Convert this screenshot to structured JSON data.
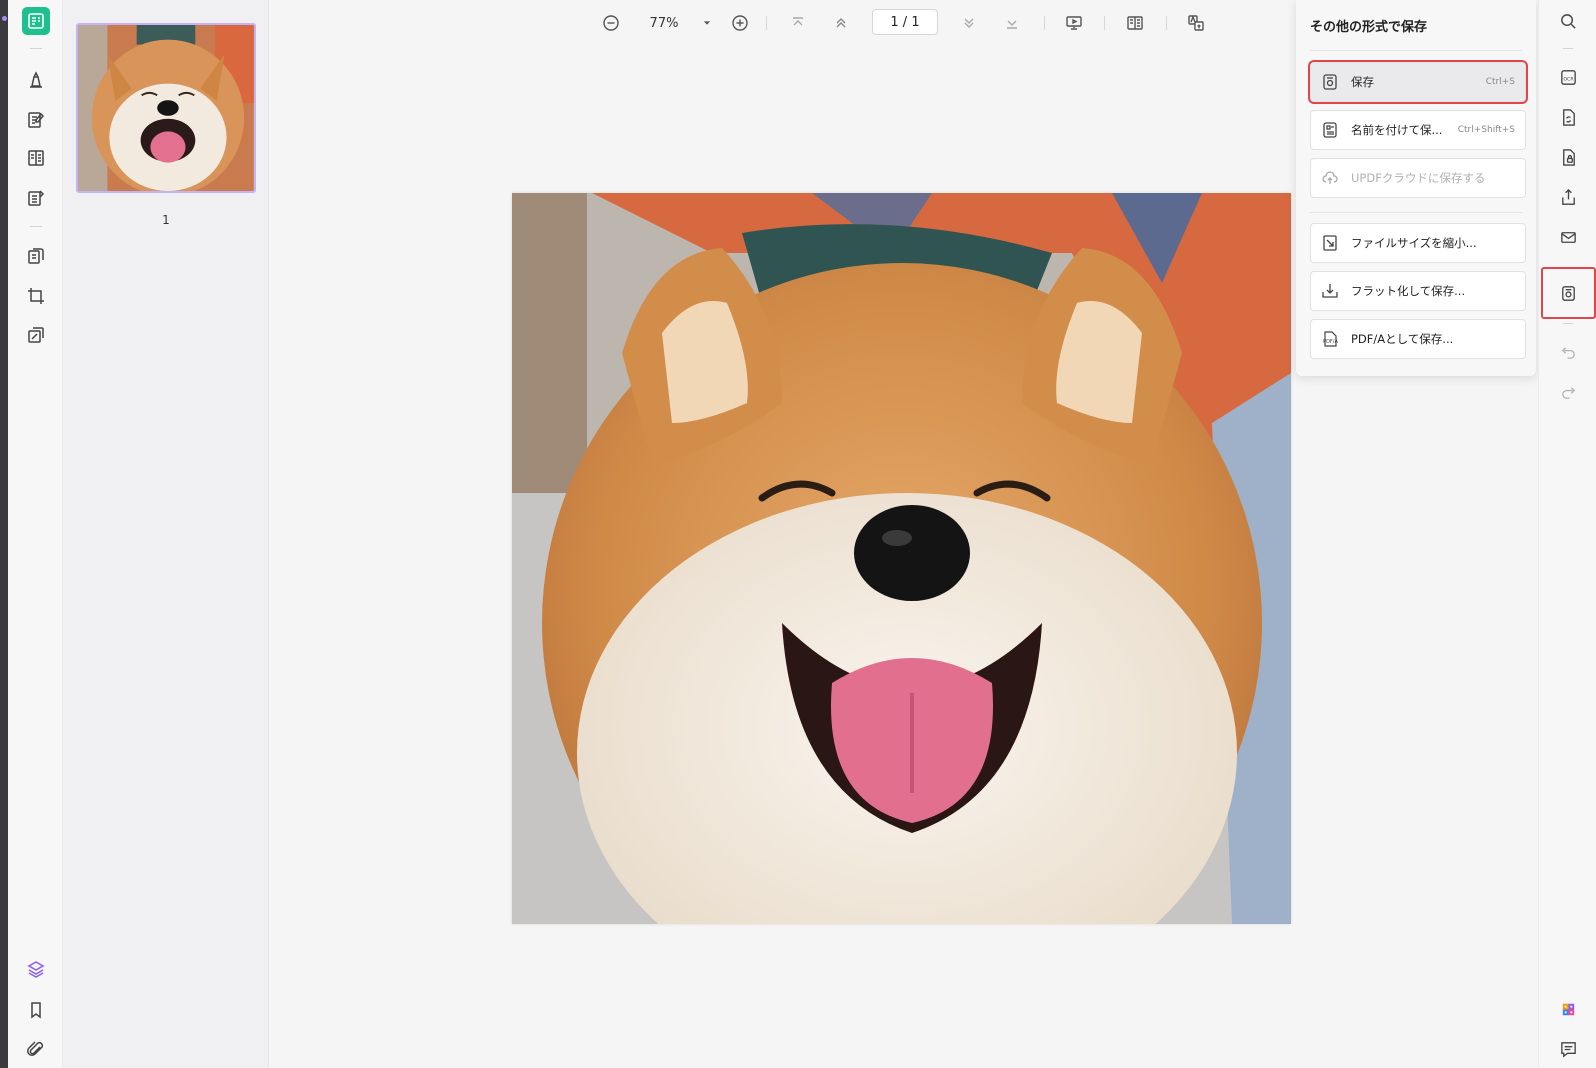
{
  "thumbnails": [
    {
      "page_number": "1"
    }
  ],
  "toolbar": {
    "zoom_value": "77%",
    "page_indicator": "1 / 1"
  },
  "save_panel": {
    "title": "その他の形式で保存",
    "options": [
      {
        "label": "保存",
        "shortcut": "Ctrl+S",
        "icon": "save-icon",
        "state": "highlighted"
      },
      {
        "label": "名前を付けて保...",
        "shortcut": "Ctrl+Shift+S",
        "icon": "save-as-icon",
        "state": "normal"
      },
      {
        "label": "UPDFクラウドに保存する",
        "shortcut": "",
        "icon": "cloud-save-icon",
        "state": "disabled"
      },
      {
        "label": "ファイルサイズを縮小...",
        "shortcut": "",
        "icon": "compress-icon",
        "state": "normal"
      },
      {
        "label": "フラット化して保存...",
        "shortcut": "",
        "icon": "flatten-icon",
        "state": "normal"
      },
      {
        "label": "PDF/Aとして保存...",
        "shortcut": "",
        "icon": "pdfa-icon",
        "state": "normal"
      }
    ]
  },
  "colors": {
    "accent_green": "#1fbf8f",
    "highlight_red": "#e0474c",
    "thumb_border": "#c5b4f5"
  }
}
